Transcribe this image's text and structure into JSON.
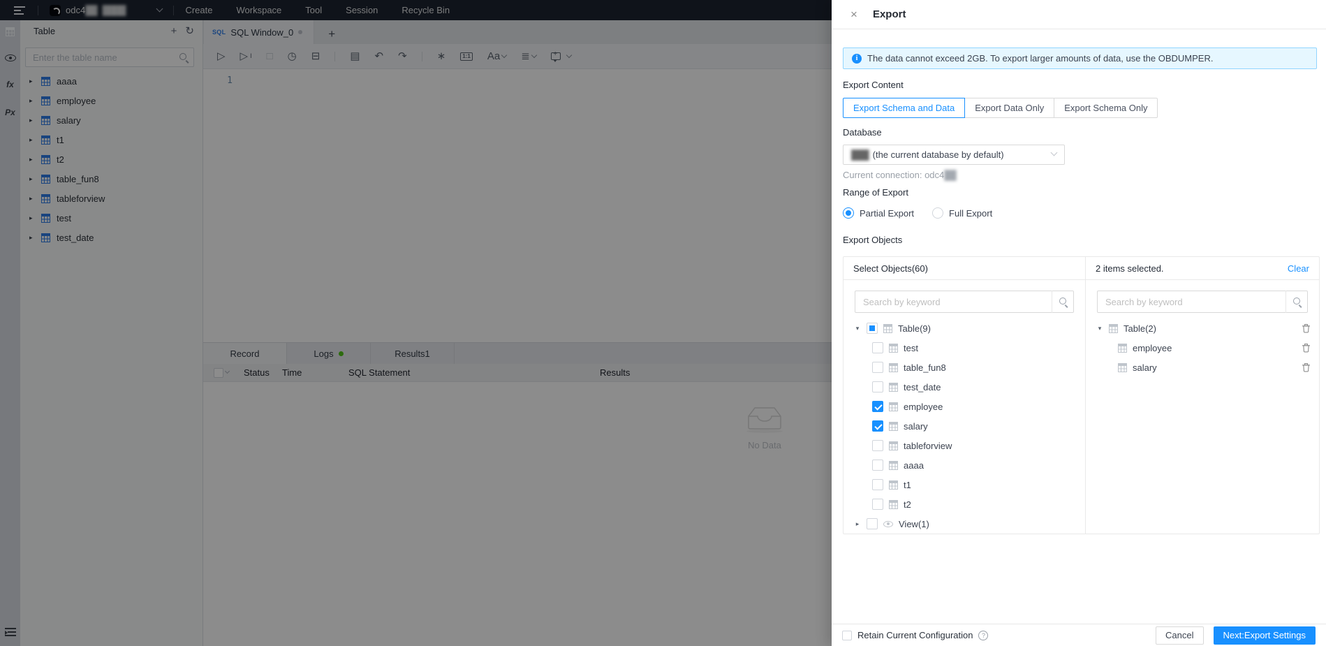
{
  "topnav": {
    "logo_text": "odc4",
    "logo_text_censored": "██",
    "connection_censored": "████",
    "menu": [
      "Create",
      "Workspace",
      "Tool",
      "Session",
      "Recycle Bin"
    ]
  },
  "activity_bar": {
    "fx_label": "fx",
    "px_label": "Px"
  },
  "sidebar": {
    "title": "Table",
    "search_placeholder": "Enter the table name",
    "items": [
      "aaaa",
      "employee",
      "salary",
      "t1",
      "t2",
      "table_fun8",
      "tableforview",
      "test",
      "test_date"
    ]
  },
  "editor": {
    "tab_icon": "SQL",
    "tab_label": "SQL Window_0",
    "line_number": "1",
    "toolbar": {
      "case_label": "Aa",
      "ratio_label": "1:1"
    }
  },
  "results": {
    "tabs": [
      "Record",
      "Logs",
      "Results1"
    ],
    "columns": [
      "Status",
      "Time",
      "SQL Statement",
      "Results"
    ],
    "empty_text": "No Data"
  },
  "drawer": {
    "title": "Export",
    "alert": "The data cannot exceed 2GB. To export larger amounts of data, use the OBDUMPER.",
    "export_content": {
      "label": "Export Content",
      "options": [
        "Export Schema and Data",
        "Export Data Only",
        "Export Schema Only"
      ],
      "selected": "Export Schema and Data"
    },
    "database": {
      "label": "Database",
      "value_censored": "███",
      "value": "(the current database by default)",
      "helper": "Current connection: odc4",
      "helper_censored": "██"
    },
    "range": {
      "label": "Range of Export",
      "options": [
        "Partial Export",
        "Full Export"
      ],
      "selected": "Partial Export"
    },
    "objects": {
      "label": "Export Objects",
      "left": {
        "title": "Select Objects(60)",
        "search_placeholder": "Search by keyword",
        "rows": [
          {
            "label": "Table(9)",
            "type": "table-group",
            "checkbox": "indeterminate",
            "expanded": true
          },
          {
            "label": "test",
            "checkbox": "off"
          },
          {
            "label": "table_fun8",
            "checkbox": "off"
          },
          {
            "label": "test_date",
            "checkbox": "off"
          },
          {
            "label": "employee",
            "checkbox": "on"
          },
          {
            "label": "salary",
            "checkbox": "on"
          },
          {
            "label": "tableforview",
            "checkbox": "off"
          },
          {
            "label": "aaaa",
            "checkbox": "off"
          },
          {
            "label": "t1",
            "checkbox": "off"
          },
          {
            "label": "t2",
            "checkbox": "off"
          },
          {
            "label": "View(1)",
            "type": "view-group",
            "checkbox": "off",
            "expanded": false
          }
        ]
      },
      "right": {
        "title": "2 items selected.",
        "clear_label": "Clear",
        "search_placeholder": "Search by keyword",
        "rows": [
          {
            "label": "Table(2)",
            "type": "table-group",
            "expanded": true
          },
          {
            "label": "employee"
          },
          {
            "label": "salary"
          }
        ]
      }
    },
    "footer": {
      "retain_label": "Retain Current Configuration",
      "cancel_label": "Cancel",
      "next_label": "Next:Export Settings"
    }
  },
  "colors": {
    "accent": "#1890ff",
    "alert_bg": "#e6f7ff",
    "alert_border": "#91d5ff",
    "success_dot": "#52c41a",
    "link": "#1890ff"
  }
}
